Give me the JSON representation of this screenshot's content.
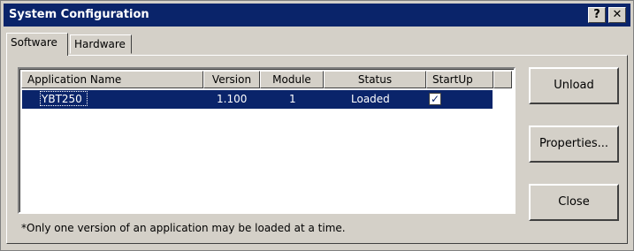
{
  "window": {
    "title": "System Configuration",
    "help_label": "?",
    "close_label": "✕"
  },
  "tabs": [
    {
      "label": "Software",
      "active": true
    },
    {
      "label": "Hardware",
      "active": false
    }
  ],
  "list": {
    "columns": [
      "Application Name",
      "Version",
      "Module",
      "Status",
      "StartUp"
    ],
    "rows": [
      {
        "name": "YBT250",
        "version": "1.100",
        "module": "1",
        "status": "Loaded",
        "startup_checked": true,
        "selected": true
      }
    ]
  },
  "buttons": {
    "unload": "Unload",
    "properties": "Properties...",
    "close": "Close"
  },
  "footnote": "*Only one version of an application may be loaded at a time.",
  "colors": {
    "titlebar": "#0a246a",
    "face": "#d4d0c8",
    "selection": "#0a246a"
  }
}
